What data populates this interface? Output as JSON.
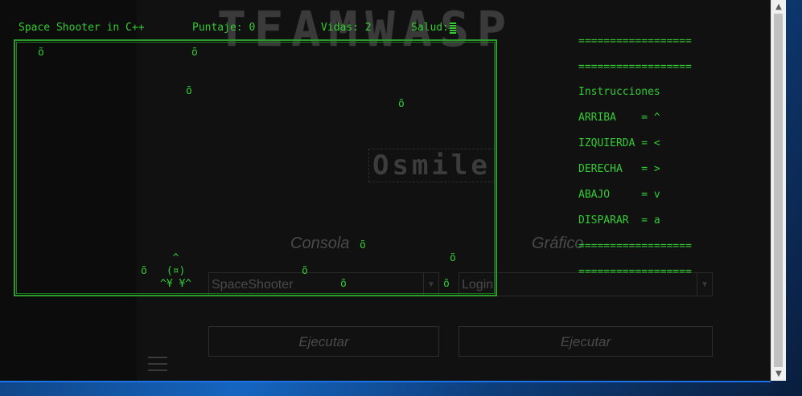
{
  "header": {
    "title": "Space Shooter in C++",
    "score": "Puntaje: 0",
    "lives": "Vidas: 2",
    "health": "Salud:"
  },
  "instructions": {
    "sep1": "==================",
    "sep2": "==================",
    "heading": "Instrucciones",
    "lines": [
      "ARRIBA    = ^",
      "IZQUIERDA = <",
      "DERECHA   = >",
      "ABAJO     = v",
      "DISPARAR  = a"
    ],
    "sep3": "==================",
    "sep4": "=================="
  },
  "game": {
    "asteroid_glyph": "õ",
    "ship": [
      "  ^",
      " (¤)",
      "^¥ ¥^"
    ]
  },
  "background_app": {
    "logo": "TEAMWASP",
    "sublogo": "Osmile",
    "console_label": "Consola",
    "graphic_label": "Gráfico",
    "console_select": "SpaceShooter",
    "graphic_select": "Login",
    "run_label_left": "Ejecutar",
    "run_label_right": "Ejecutar"
  },
  "colors": {
    "terminal_green": "#33cc33",
    "background": "#0c0c0c"
  },
  "scrollbar": {
    "up_icon": "▲",
    "down_icon": "▼"
  }
}
